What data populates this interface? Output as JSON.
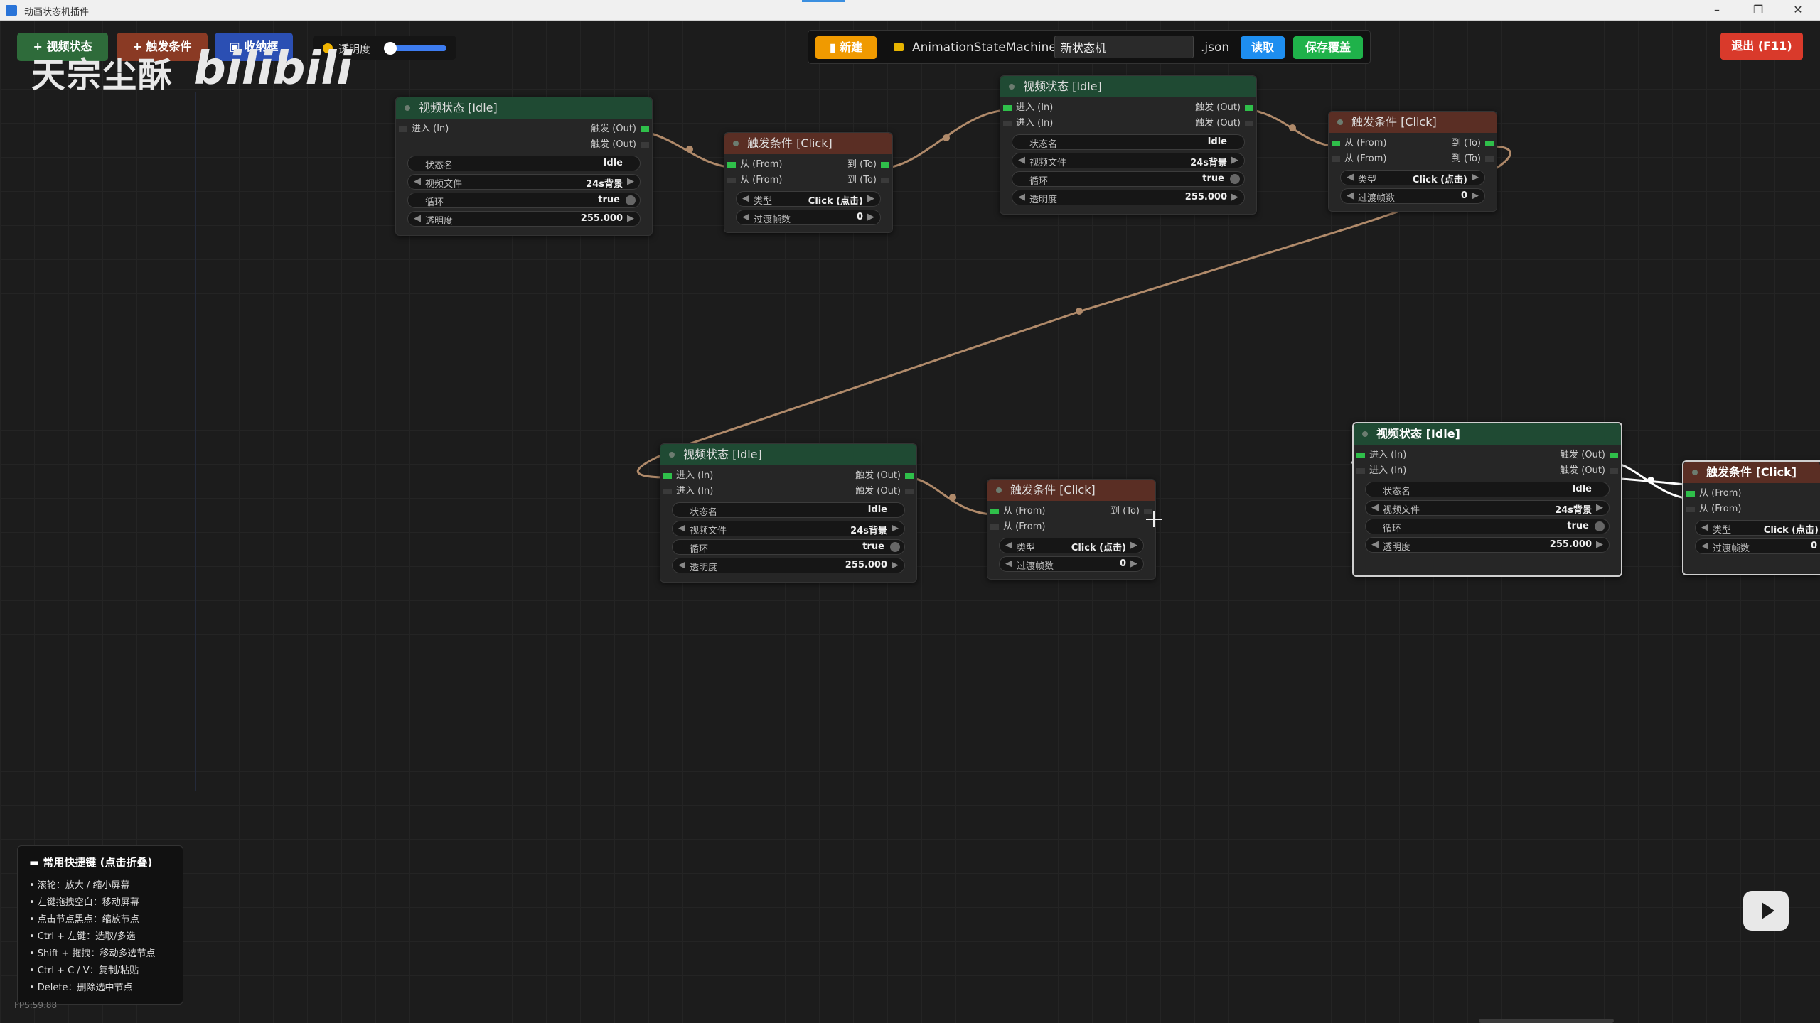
{
  "window": {
    "title": "动画状态机插件",
    "minimize": "–",
    "maximize": "❐",
    "close": "✕"
  },
  "toolbar": {
    "video_btn": "+ 视频状态",
    "trigger_btn": "+ 触发条件",
    "box_btn": "▣ 收纳框",
    "opacity_label": "透明度"
  },
  "filebar": {
    "new_btn": "▮ 新建",
    "path_prefix": "AnimationStateMachine/",
    "filename": "新状态机",
    "ext": ".json",
    "load_btn": "读取",
    "save_btn": "保存覆盖"
  },
  "exit_btn": "退出 (F11)",
  "watermark": {
    "left": "天宗尘酥",
    "right": "bilibili"
  },
  "labels": {
    "in": "进入 (In)",
    "out": "触发 (Out)",
    "from": "从 (From)",
    "to": "到 (To)",
    "state_name": "状态名",
    "video_file": "视频文件",
    "loop": "循环",
    "opacity": "透明度",
    "type": "类型",
    "transition": "过渡帧数"
  },
  "video_nodes": [
    {
      "title": "视频状态 [Idle]",
      "state": "Idle",
      "file": "24s背景",
      "loop": "true",
      "opacity": "255.000"
    },
    {
      "title": "视频状态 [Idle]",
      "state": "Idle",
      "file": "24s背景",
      "loop": "true",
      "opacity": "255.000"
    },
    {
      "title": "视频状态 [Idle]",
      "state": "Idle",
      "file": "24s背景",
      "loop": "true",
      "opacity": "255.000"
    },
    {
      "title": "视频状态 [Idle]",
      "state": "Idle",
      "file": "24s背景",
      "loop": "true",
      "opacity": "255.000"
    }
  ],
  "trigger_nodes": [
    {
      "title": "触发条件 [Click]",
      "type": "Click (点击)",
      "frames": "0"
    },
    {
      "title": "触发条件 [Click]",
      "type": "Click (点击)",
      "frames": "0"
    },
    {
      "title": "触发条件 [Click]",
      "type": "Click (点击)",
      "frames": "0"
    },
    {
      "title": "触发条件 [Click]",
      "type": "Click (点击)",
      "frames": "0"
    }
  ],
  "shortcuts": {
    "title": "▬ 常用快捷键 (点击折叠)",
    "items": [
      "• 滚轮：放大 / 缩小屏幕",
      "• 左键拖拽空白：移动屏幕",
      "• 点击节点黑点：缩放节点",
      "• Ctrl + 左键：选取/多选",
      "• Shift + 拖拽：移动多选节点",
      "• Ctrl + C / V：复制/粘贴",
      "• Delete：删除选中节点"
    ]
  },
  "fps": "FPS:59.88",
  "colors": {
    "wire": "#b08a6a",
    "video_header": "#1f4a33",
    "trigger_header": "#5a2e24",
    "accent_green": "#2fbf4a"
  }
}
